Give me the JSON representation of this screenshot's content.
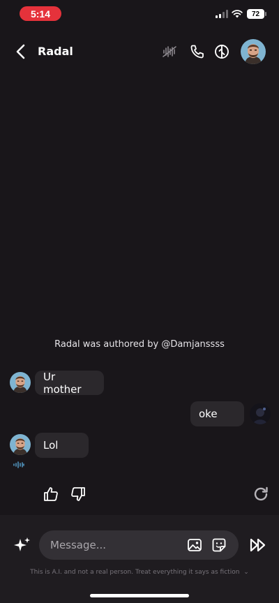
{
  "status_bar": {
    "time": "5:14",
    "battery": "72",
    "signal_icon": "cellular-signal-icon",
    "wifi_icon": "wifi-icon"
  },
  "header": {
    "title": "Radal",
    "back_icon": "chevron-left-icon",
    "icons": [
      "voice-waveform-icon",
      "phone-icon",
      "character-settings-icon"
    ]
  },
  "chat": {
    "author_note": "Radal was authored by @Damjanssss",
    "messages": [
      {
        "sender": "bot",
        "text": "Ur mother"
      },
      {
        "sender": "user",
        "text": "oke"
      },
      {
        "sender": "bot",
        "text": "Lol"
      }
    ]
  },
  "actions": {
    "icons": [
      "thumbs-up-icon",
      "thumbs-down-icon",
      "regenerate-icon"
    ]
  },
  "composer": {
    "placeholder": "Message...",
    "disclaimer": "This is A.I. and not a real person. Treat everything it says as fiction",
    "icons": [
      "sparkle-icon",
      "image-icon",
      "sticker-icon",
      "send-icon"
    ]
  },
  "colors": {
    "background": "#19161a",
    "bubble": "#2b282c",
    "time_pill": "#e5323b",
    "composer": "#1f1c20"
  }
}
